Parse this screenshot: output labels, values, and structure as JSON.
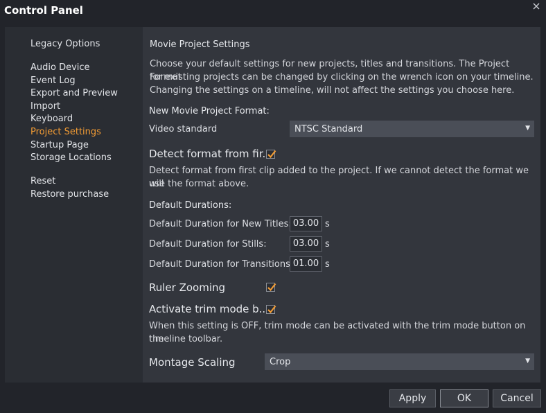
{
  "window": {
    "title": "Control Panel",
    "close_icon": "close-icon"
  },
  "nav": {
    "items": [
      {
        "label": "Legacy Options"
      },
      {
        "label": "Audio Device"
      },
      {
        "label": "Event Log"
      },
      {
        "label": "Export and Preview"
      },
      {
        "label": "Import"
      },
      {
        "label": "Keyboard"
      },
      {
        "label": "Project Settings",
        "active": true
      },
      {
        "label": "Startup Page"
      },
      {
        "label": "Storage Locations"
      },
      {
        "label": "Reset"
      },
      {
        "label": "Restore purchase"
      }
    ],
    "active_color": "#f39c34"
  },
  "content": {
    "heading": "Movie Project Settings",
    "intro_lines": [
      "Choose your default settings for new projects, titles and transitions. The Project Format",
      "for existing projects can be changed by clicking on the wrench icon on your timeline.",
      "Changing the settings on a timeline, will not affect the settings you choose here."
    ],
    "format_heading": "New Movie Project Format:",
    "video_standard_label": "Video standard",
    "video_standard_value": "NTSC Standard",
    "detect_label": "Detect format from fir...",
    "detect_checked": true,
    "detect_desc_lines": [
      "Detect format from first clip added to the project. If we cannot detect the format we will",
      "use the format above."
    ],
    "durations_heading": "Default Durations:",
    "durations": [
      {
        "label": "Default Duration for New Titles:",
        "value": "03.00",
        "unit": "s"
      },
      {
        "label": "Default Duration for Stills:",
        "value": "03.00",
        "unit": "s"
      },
      {
        "label": "Default Duration for Transitions:",
        "value": "01.00",
        "unit": "s"
      }
    ],
    "ruler_label": "Ruler Zooming",
    "ruler_checked": true,
    "trim_label": "Activate trim mode b...",
    "trim_checked": true,
    "trim_desc_lines": [
      "When this setting is OFF, trim mode can be activated with the trim mode button on the",
      "timeline toolbar."
    ],
    "montage_label": "Montage Scaling",
    "montage_value": "Crop"
  },
  "footer": {
    "apply": "Apply",
    "ok": "OK",
    "cancel": "Cancel"
  },
  "colors": {
    "accent": "#f39c34",
    "panel": "#33363d",
    "nav_bg": "#2a2d33",
    "window_bg": "#22242a"
  }
}
